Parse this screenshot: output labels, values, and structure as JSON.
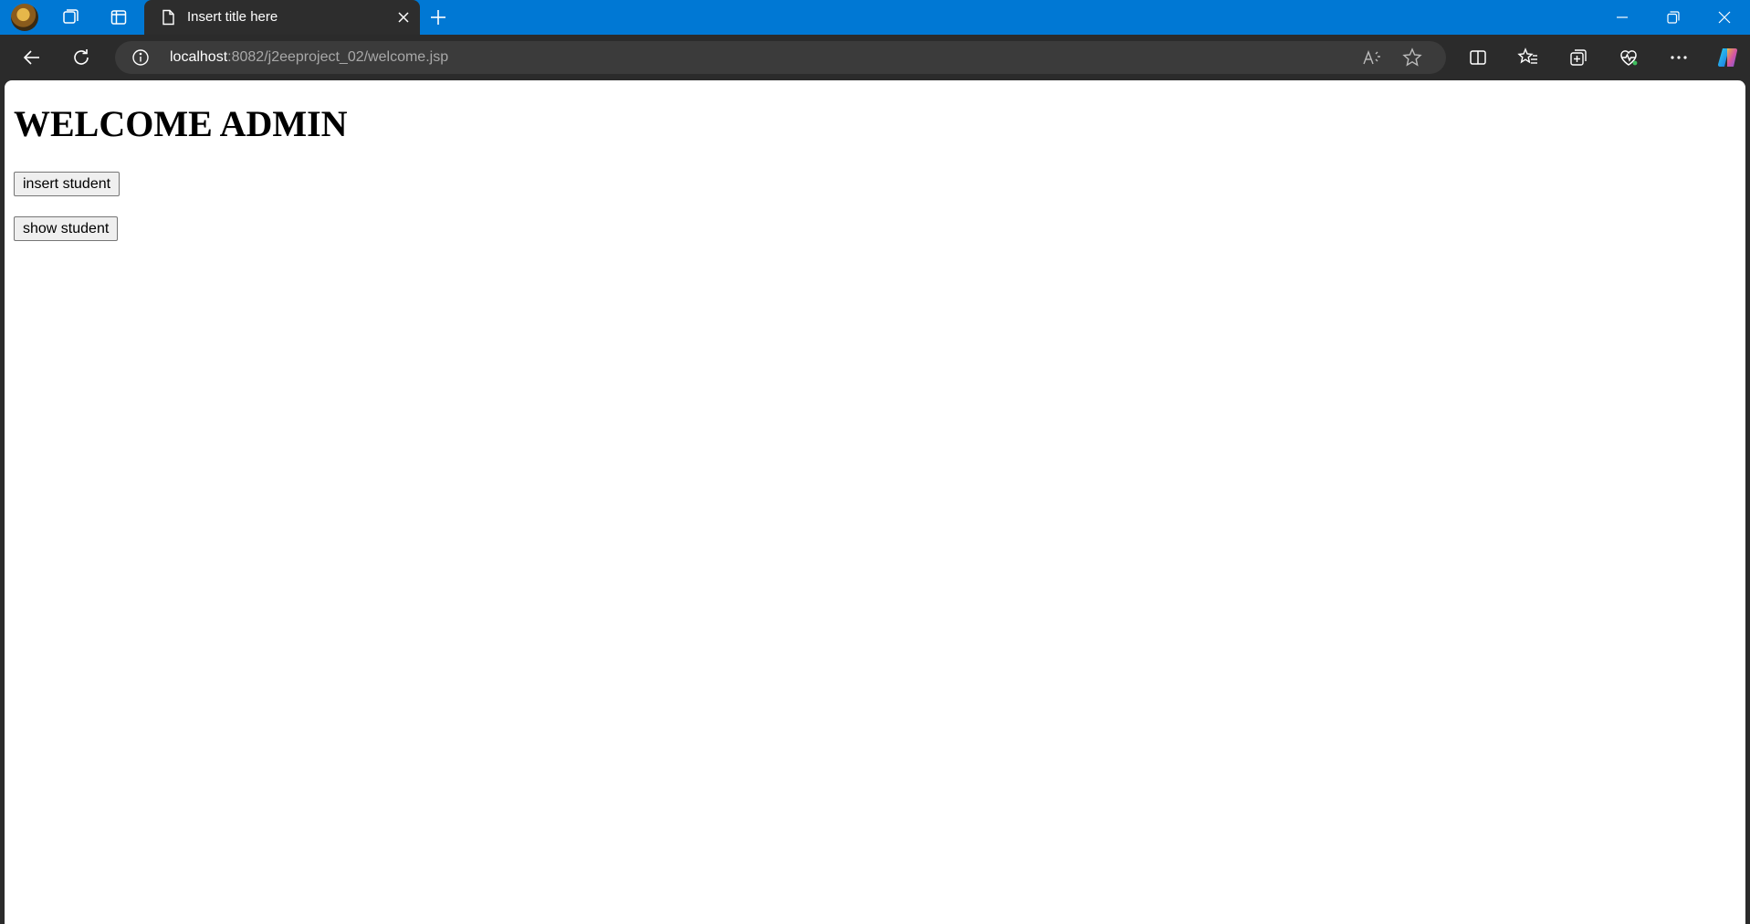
{
  "browser": {
    "tab_title": "Insert title here",
    "url_host": "localhost",
    "url_path": ":8082/j2eeproject_02/welcome.jsp"
  },
  "icons": {
    "profile": "profile-avatar-icon",
    "workspaces": "workspaces-icon",
    "vertical_tabs": "tab-actions-icon",
    "tab_page": "page-icon",
    "close_tab": "close-icon",
    "new_tab": "plus-icon",
    "back": "back-arrow-icon",
    "refresh": "refresh-icon",
    "site_info": "info-icon",
    "read_aloud": "read-aloud-icon",
    "favorite": "star-icon",
    "split_screen": "split-screen-icon",
    "favorites": "favorites-list-icon",
    "collections": "collections-icon",
    "browser_essentials": "heart-pulse-icon",
    "more": "more-dots-icon",
    "copilot": "copilot-icon"
  },
  "page": {
    "heading": "WELCOME ADMIN",
    "insert_button": "insert student",
    "show_button": "show student"
  },
  "colors": {
    "titlebar": "#0078d4",
    "chrome_dark": "#2b2b2b",
    "page_background": "#ffffff"
  }
}
